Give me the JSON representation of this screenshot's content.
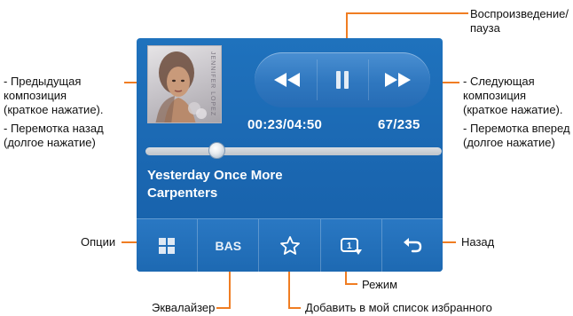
{
  "player": {
    "time": "00:23/04:50",
    "track_count": "67/235",
    "progress": 0.24,
    "song_title": "Yesterday Once More",
    "song_artist": "Carpenters",
    "cover_text": "JENNIFER LOPEZ",
    "equalizer_label": "BAS"
  },
  "annotations": {
    "play_pause": "Воспроизведение/\nпауза",
    "prev_short": "- Предыдущая\nкомпозиция\n(краткое нажатие).",
    "prev_long": "- Перемотка назад\n(долгое нажатие)",
    "next_short": "- Следующая\nкомпозиция\n(краткое нажатие).",
    "next_long": "- Перемотка вперед\n(долгое нажатие)",
    "options": "Опции",
    "back": "Назад",
    "mode": "Режим",
    "equalizer": "Эквалайзер",
    "favorites": "Добавить в мой список избранного"
  },
  "colors": {
    "accent_line": "#f07d22",
    "screen_bg": "#1f72bd",
    "text_white": "#ffffff"
  },
  "icons": {
    "prev": "rewind-icon",
    "pause": "pause-icon",
    "next": "fast-forward-icon",
    "options": "grid-icon",
    "favorites": "star-icon",
    "mode": "repeat-one-icon",
    "back": "back-arrow-icon"
  }
}
